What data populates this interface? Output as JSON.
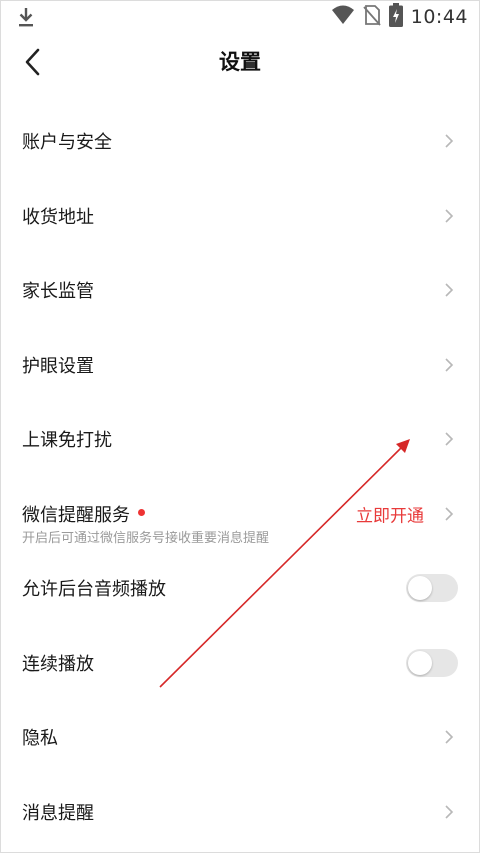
{
  "status_bar": {
    "time": "10:44",
    "icons": [
      "download-icon",
      "wifi-icon",
      "no-sim-icon",
      "battery-charging-icon"
    ]
  },
  "header": {
    "title": "设置",
    "back_icon": "chevron-left-icon"
  },
  "settings": {
    "items": [
      {
        "label": "账户与安全"
      },
      {
        "label": "收货地址"
      },
      {
        "label": "家长监管"
      },
      {
        "label": "护眼设置"
      },
      {
        "label": "上课免打扰"
      },
      {
        "label": "微信提醒服务",
        "description": "开启后可通过微信服务号接收重要消息提醒",
        "action": "立即开通"
      },
      {
        "label": "允许后台音频播放",
        "toggle_on": false
      },
      {
        "label": "连续播放",
        "toggle_on": false
      },
      {
        "label": "隐私"
      },
      {
        "label": "消息提醒"
      }
    ]
  },
  "colors": {
    "accent_red": "#e83a3a",
    "annotation_arrow": "#d62828",
    "toggle_off": "#e6e6e6"
  }
}
